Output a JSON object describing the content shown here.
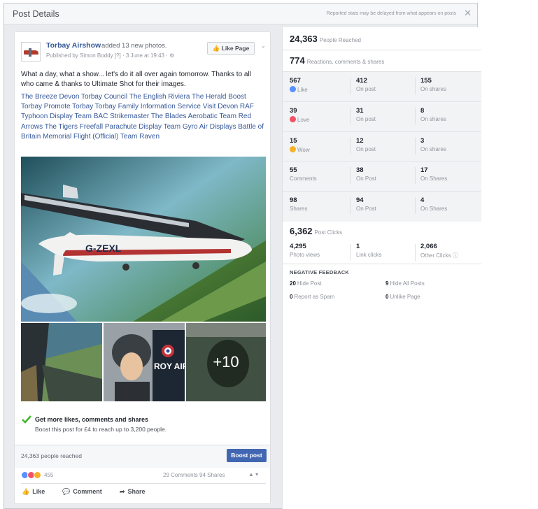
{
  "dialog": {
    "title": "Post Details",
    "header_note": "Reported stats may be delayed from what appears on posts",
    "close_glyph": "✕"
  },
  "post": {
    "page_name": "Torbay Airshow",
    "added_text": "added 13 new photos.",
    "published_line": "Published by Simon Boddy [?] · 3 June at 19:43 · ⚙",
    "like_page_label": "Like Page",
    "more_glyph": "⌄",
    "text": "What a day, what a show... let's do it all over again tomorrow. Thanks to all who came & thanks to Ultimate Shot for their images.",
    "tags": "The Breeze Devon Torbay Council The English Riviera The Herald Boost Torbay Promote Torbay Torbay Family Information Service Visit Devon RAF Typhoon Display Team BAC Strikemaster The Blades Aerobatic Team Red Arrows The Tigers Freefall Parachute Display Team Gyro Air Displays Battle of Britain Memorial Flight (Official) Team Raven",
    "plane_reg": "G-ZEXL",
    "thumb_sign": "ROY AIR FOR TYPHO DISPLAY T",
    "more_photos": "+10",
    "promo_title": "Get more likes, comments and shares",
    "promo_sub": "Boost this post for £4 to reach up to 3,200 people.",
    "reached_text": "24,363 people reached",
    "boost_label": "Boost post",
    "reaction_count": "455",
    "comments_shares": "29 Comments  94 Shares",
    "actions": {
      "like": "Like",
      "comment": "Comment",
      "share": "Share"
    }
  },
  "stats": {
    "people_reached": {
      "value": "24,363",
      "label": "People Reached"
    },
    "reactions_total": {
      "value": "774",
      "label": "Reactions, comments & shares"
    },
    "breakdown": [
      {
        "total": "567",
        "label": "Like",
        "on_post": "412",
        "on_post_label": "On post",
        "on_shares": "155",
        "on_shares_label": "On shares"
      },
      {
        "total": "39",
        "label": "Love",
        "on_post": "31",
        "on_post_label": "On post",
        "on_shares": "8",
        "on_shares_label": "On shares"
      },
      {
        "total": "15",
        "label": "Wow",
        "on_post": "12",
        "on_post_label": "On post",
        "on_shares": "3",
        "on_shares_label": "On shares"
      },
      {
        "total": "55",
        "label": "Comments",
        "on_post": "38",
        "on_post_label": "On Post",
        "on_shares": "17",
        "on_shares_label": "On Shares"
      },
      {
        "total": "98",
        "label": "Shares",
        "on_post": "94",
        "on_post_label": "On Post",
        "on_shares": "4",
        "on_shares_label": "On Shares"
      }
    ],
    "post_clicks": {
      "value": "6,362",
      "label": "Post Clicks"
    },
    "clicks": [
      {
        "value": "4,295",
        "label": "Photo views"
      },
      {
        "value": "1",
        "label": "Link clicks"
      },
      {
        "value": "2,066",
        "label": "Other Clicks ⓘ"
      }
    ],
    "negative_title": "NEGATIVE FEEDBACK",
    "negative": [
      {
        "value": "20",
        "label": "Hide Post"
      },
      {
        "value": "9",
        "label": "Hide All Posts"
      },
      {
        "value": "0",
        "label": "Report as Spam"
      },
      {
        "value": "0",
        "label": "Unlike Page"
      }
    ]
  },
  "colors": {
    "link_blue": "#365899",
    "boost_blue": "#4267b2",
    "like_blue": "#5890ff",
    "love_red": "#f25268",
    "wow_yellow": "#f7b125",
    "check_green": "#42b72a"
  }
}
